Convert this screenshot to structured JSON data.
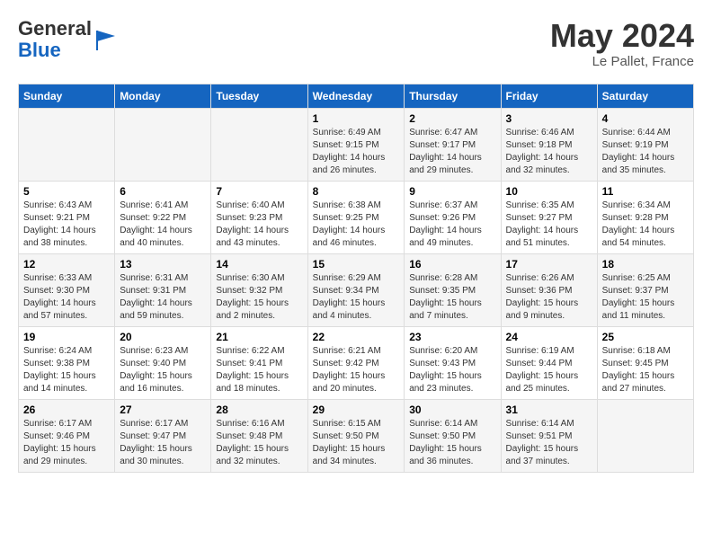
{
  "header": {
    "logo_general": "General",
    "logo_blue": "Blue",
    "month_title": "May 2024",
    "location": "Le Pallet, France"
  },
  "weekdays": [
    "Sunday",
    "Monday",
    "Tuesday",
    "Wednesday",
    "Thursday",
    "Friday",
    "Saturday"
  ],
  "weeks": [
    [
      {
        "day": "",
        "info": ""
      },
      {
        "day": "",
        "info": ""
      },
      {
        "day": "",
        "info": ""
      },
      {
        "day": "1",
        "info": "Sunrise: 6:49 AM\nSunset: 9:15 PM\nDaylight: 14 hours and 26 minutes."
      },
      {
        "day": "2",
        "info": "Sunrise: 6:47 AM\nSunset: 9:17 PM\nDaylight: 14 hours and 29 minutes."
      },
      {
        "day": "3",
        "info": "Sunrise: 6:46 AM\nSunset: 9:18 PM\nDaylight: 14 hours and 32 minutes."
      },
      {
        "day": "4",
        "info": "Sunrise: 6:44 AM\nSunset: 9:19 PM\nDaylight: 14 hours and 35 minutes."
      }
    ],
    [
      {
        "day": "5",
        "info": "Sunrise: 6:43 AM\nSunset: 9:21 PM\nDaylight: 14 hours and 38 minutes."
      },
      {
        "day": "6",
        "info": "Sunrise: 6:41 AM\nSunset: 9:22 PM\nDaylight: 14 hours and 40 minutes."
      },
      {
        "day": "7",
        "info": "Sunrise: 6:40 AM\nSunset: 9:23 PM\nDaylight: 14 hours and 43 minutes."
      },
      {
        "day": "8",
        "info": "Sunrise: 6:38 AM\nSunset: 9:25 PM\nDaylight: 14 hours and 46 minutes."
      },
      {
        "day": "9",
        "info": "Sunrise: 6:37 AM\nSunset: 9:26 PM\nDaylight: 14 hours and 49 minutes."
      },
      {
        "day": "10",
        "info": "Sunrise: 6:35 AM\nSunset: 9:27 PM\nDaylight: 14 hours and 51 minutes."
      },
      {
        "day": "11",
        "info": "Sunrise: 6:34 AM\nSunset: 9:28 PM\nDaylight: 14 hours and 54 minutes."
      }
    ],
    [
      {
        "day": "12",
        "info": "Sunrise: 6:33 AM\nSunset: 9:30 PM\nDaylight: 14 hours and 57 minutes."
      },
      {
        "day": "13",
        "info": "Sunrise: 6:31 AM\nSunset: 9:31 PM\nDaylight: 14 hours and 59 minutes."
      },
      {
        "day": "14",
        "info": "Sunrise: 6:30 AM\nSunset: 9:32 PM\nDaylight: 15 hours and 2 minutes."
      },
      {
        "day": "15",
        "info": "Sunrise: 6:29 AM\nSunset: 9:34 PM\nDaylight: 15 hours and 4 minutes."
      },
      {
        "day": "16",
        "info": "Sunrise: 6:28 AM\nSunset: 9:35 PM\nDaylight: 15 hours and 7 minutes."
      },
      {
        "day": "17",
        "info": "Sunrise: 6:26 AM\nSunset: 9:36 PM\nDaylight: 15 hours and 9 minutes."
      },
      {
        "day": "18",
        "info": "Sunrise: 6:25 AM\nSunset: 9:37 PM\nDaylight: 15 hours and 11 minutes."
      }
    ],
    [
      {
        "day": "19",
        "info": "Sunrise: 6:24 AM\nSunset: 9:38 PM\nDaylight: 15 hours and 14 minutes."
      },
      {
        "day": "20",
        "info": "Sunrise: 6:23 AM\nSunset: 9:40 PM\nDaylight: 15 hours and 16 minutes."
      },
      {
        "day": "21",
        "info": "Sunrise: 6:22 AM\nSunset: 9:41 PM\nDaylight: 15 hours and 18 minutes."
      },
      {
        "day": "22",
        "info": "Sunrise: 6:21 AM\nSunset: 9:42 PM\nDaylight: 15 hours and 20 minutes."
      },
      {
        "day": "23",
        "info": "Sunrise: 6:20 AM\nSunset: 9:43 PM\nDaylight: 15 hours and 23 minutes."
      },
      {
        "day": "24",
        "info": "Sunrise: 6:19 AM\nSunset: 9:44 PM\nDaylight: 15 hours and 25 minutes."
      },
      {
        "day": "25",
        "info": "Sunrise: 6:18 AM\nSunset: 9:45 PM\nDaylight: 15 hours and 27 minutes."
      }
    ],
    [
      {
        "day": "26",
        "info": "Sunrise: 6:17 AM\nSunset: 9:46 PM\nDaylight: 15 hours and 29 minutes."
      },
      {
        "day": "27",
        "info": "Sunrise: 6:17 AM\nSunset: 9:47 PM\nDaylight: 15 hours and 30 minutes."
      },
      {
        "day": "28",
        "info": "Sunrise: 6:16 AM\nSunset: 9:48 PM\nDaylight: 15 hours and 32 minutes."
      },
      {
        "day": "29",
        "info": "Sunrise: 6:15 AM\nSunset: 9:50 PM\nDaylight: 15 hours and 34 minutes."
      },
      {
        "day": "30",
        "info": "Sunrise: 6:14 AM\nSunset: 9:50 PM\nDaylight: 15 hours and 36 minutes."
      },
      {
        "day": "31",
        "info": "Sunrise: 6:14 AM\nSunset: 9:51 PM\nDaylight: 15 hours and 37 minutes."
      },
      {
        "day": "",
        "info": ""
      }
    ]
  ]
}
